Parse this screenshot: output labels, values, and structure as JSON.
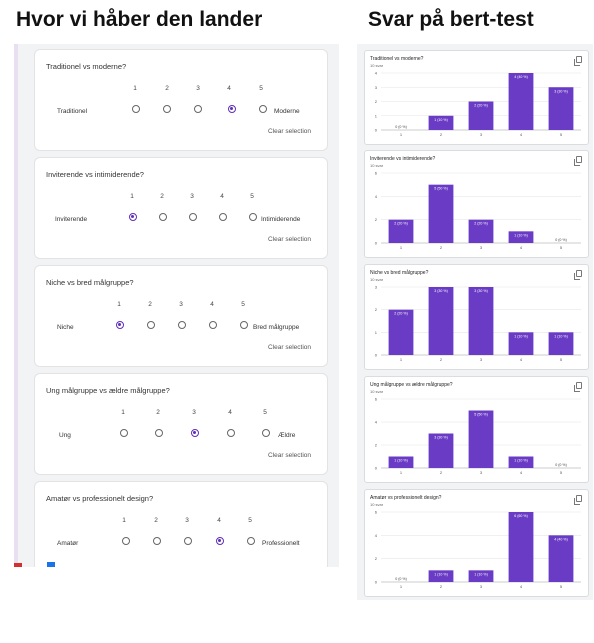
{
  "titles": {
    "left": "Hvor vi håber den lander",
    "right": "Svar på bert-test"
  },
  "form": {
    "clear_label": "Clear selection",
    "scale": [
      "1",
      "2",
      "3",
      "4",
      "5"
    ],
    "questions": [
      {
        "title": "Traditionel vs moderne?",
        "left": "Traditionel",
        "right": "Moderne",
        "selected": 4
      },
      {
        "title": "Inviterende vs intimiderende?",
        "left": "Inviterende",
        "right": "Intimiderende",
        "selected": 1
      },
      {
        "title": "Niche vs bred målgruppe?",
        "left": "Niche",
        "right": "Bred målgruppe",
        "selected": 1
      },
      {
        "title": "Ung målgruppe vs ældre målgruppe?",
        "left": "Ung",
        "right": "Ældre",
        "selected": 3
      },
      {
        "title": "Amatør vs professionelt design?",
        "left": "Amatør",
        "right": "Professionelt",
        "selected": 4
      }
    ]
  },
  "colors": {
    "bar": "#6a3bc5",
    "accent": "#5f2eb8"
  },
  "chart_data": [
    {
      "type": "bar",
      "title": "Traditionel vs moderne?",
      "subtitle": "10 svar",
      "categories": [
        "1",
        "2",
        "3",
        "4",
        "5"
      ],
      "values": [
        0,
        1,
        2,
        4,
        3
      ],
      "labels": [
        "0 (0 %)",
        "1 (10 %)",
        "2 (20 %)",
        "4 (40 %)",
        "3 (30 %)"
      ],
      "yticks": [
        "0",
        "1",
        "2",
        "3",
        "4"
      ],
      "ylim": [
        0,
        4
      ]
    },
    {
      "type": "bar",
      "title": "Inviterende vs intimiderende?",
      "subtitle": "10 svar",
      "categories": [
        "1",
        "2",
        "3",
        "4",
        "5"
      ],
      "values": [
        2,
        5,
        2,
        1,
        0
      ],
      "labels": [
        "2 (20 %)",
        "5 (50 %)",
        "2 (20 %)",
        "1 (10 %)",
        "0 (0 %)"
      ],
      "yticks": [
        "0",
        "2",
        "4",
        "6"
      ],
      "ylim": [
        0,
        6
      ]
    },
    {
      "type": "bar",
      "title": "Niche vs bred målgruppe?",
      "subtitle": "10 svar",
      "categories": [
        "1",
        "2",
        "3",
        "4",
        "5"
      ],
      "values": [
        2,
        3,
        3,
        1,
        1
      ],
      "labels": [
        "2 (20 %)",
        "3 (30 %)",
        "3 (30 %)",
        "1 (10 %)",
        "1 (10 %)"
      ],
      "yticks": [
        "0",
        "1",
        "2",
        "3"
      ],
      "ylim": [
        0,
        3
      ]
    },
    {
      "type": "bar",
      "title": "Ung målgruppe vs ældre målgruppe?",
      "subtitle": "10 svar",
      "categories": [
        "1",
        "2",
        "3",
        "4",
        "5"
      ],
      "values": [
        1,
        3,
        5,
        1,
        0
      ],
      "labels": [
        "1 (10 %)",
        "3 (30 %)",
        "5 (50 %)",
        "1 (10 %)",
        "0 (0 %)"
      ],
      "yticks": [
        "0",
        "2",
        "4",
        "6"
      ],
      "ylim": [
        0,
        6
      ]
    },
    {
      "type": "bar",
      "title": "Amatør vs professionelt design?",
      "subtitle": "10 svar",
      "categories": [
        "1",
        "2",
        "3",
        "4",
        "5"
      ],
      "values": [
        0,
        1,
        1,
        6,
        4
      ],
      "labels": [
        "0 (0 %)",
        "1 (10 %)",
        "1 (10 %)",
        "6 (60 %)",
        "4 (40 %)"
      ],
      "yticks": [
        "0",
        "2",
        "4",
        "6"
      ],
      "ylim": [
        0,
        6
      ]
    }
  ]
}
